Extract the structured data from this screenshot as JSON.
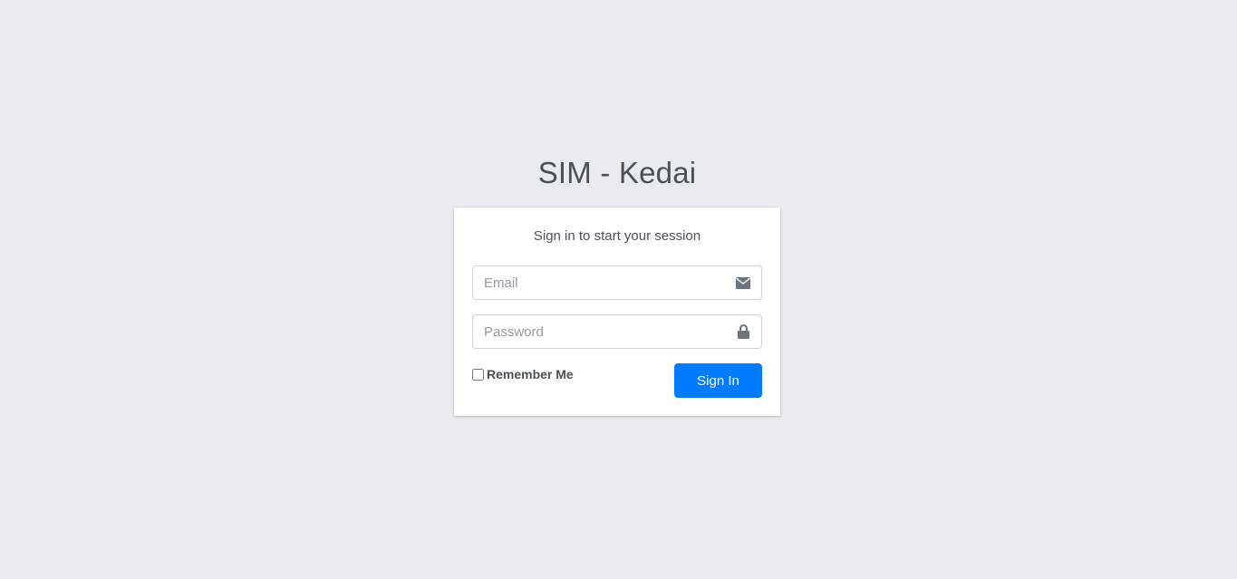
{
  "logo": {
    "brand_bold": "SIM",
    "brand_rest": " - Kedai"
  },
  "login": {
    "message": "Sign in to start your session",
    "email": {
      "placeholder": "Email",
      "value": "",
      "icon": "envelope-icon"
    },
    "password": {
      "placeholder": "Password",
      "value": "",
      "icon": "lock-icon"
    },
    "remember_label": "Remember Me",
    "remember_checked": false,
    "submit_label": "Sign In"
  },
  "colors": {
    "background": "#e9ecef",
    "card": "#ffffff",
    "primary": "#007bff",
    "text": "#495057"
  }
}
